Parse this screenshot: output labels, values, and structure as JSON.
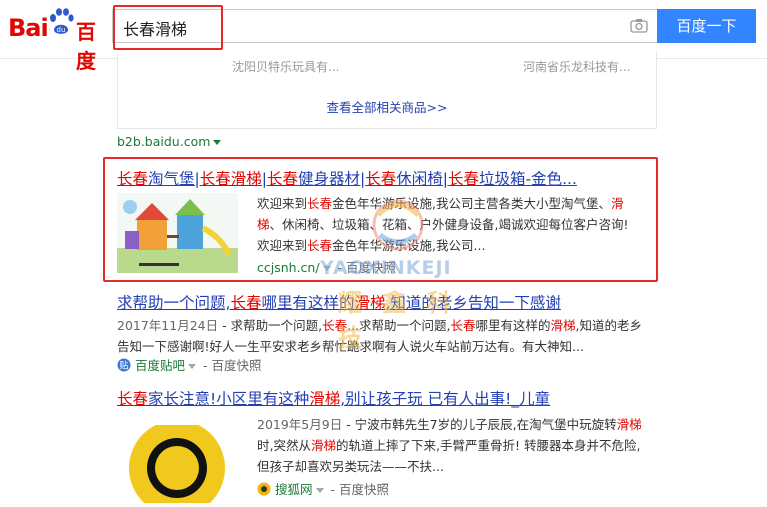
{
  "header": {
    "logo_bai": "Bai",
    "logo_du": "百度",
    "search_value": "长春滑梯",
    "search_button": "百度一下"
  },
  "product_panel": {
    "item1": "沈阳贝特乐玩具有...",
    "item2": "河南省乐龙科技有...",
    "view_all": "查看全部相关商品>>"
  },
  "source_url": "b2b.baidu.com",
  "results": [
    {
      "title_parts": [
        "长春",
        "淘气堡|",
        "长春",
        "滑梯",
        "|",
        "长春",
        "健身器材|",
        "长春",
        "休闲椅|",
        "长春",
        "垃圾箱-金色..."
      ],
      "snippet_line1_parts": [
        "欢迎来到",
        "长春",
        "金色年华游乐设施,我公司主营各类大小型淘气堡、",
        "滑"
      ],
      "snippet_line2_parts": [
        "梯",
        "、休闲椅、垃圾箱、花箱、户外健身设备,竭诚欢迎每位客户咨询!"
      ],
      "snippet_line3_parts": [
        "欢迎来到",
        "长春",
        "金色年华游乐设施,我公司..."
      ],
      "domain": "ccjsnh.cn/",
      "cache": "百度快照"
    },
    {
      "title_parts": [
        "求帮助一个问题,",
        "长春",
        "哪里有这样的",
        "滑梯",
        ",知道的老乡告知一下感谢"
      ],
      "date": "2017年11月24日",
      "snippet_line1_parts": [
        " - 求帮助一个问题,",
        "长春",
        "...求帮助一个问题,",
        "长春",
        "哪里有这样的",
        "滑梯",
        ",知道的老乡"
      ],
      "snippet_line2": "告知一下感谢啊!好人一生平安求老乡帮忙跪求啊有人说火车站前万达有。有大神知...",
      "source": "百度贴吧",
      "cache": "百度快照"
    },
    {
      "title_parts": [
        "长春",
        "家长注意!小区里有这种",
        "滑梯",
        ",别让孩子玩 已有人出事!_儿童"
      ],
      "date": "2019年5月9日",
      "snippet_line1": " - 宁波市韩先生7岁的儿子辰辰,在淘气堡中玩旋转",
      "snippet_line1_hl": "滑梯",
      "snippet_line2_parts": [
        "时,突然从",
        "滑梯",
        "的轨道上摔了下来,手臂严重骨折! 转腰器本身并不危险,"
      ],
      "snippet_line3": "但孩子却喜欢另类玩法——不扶...",
      "source": "搜狐网",
      "cache": "百度快照"
    }
  ],
  "watermark": {
    "line1": "YAOXINKEJI",
    "line2": "耀 鑫 科 技"
  },
  "colors": {
    "brand_red": "#e10602",
    "link_blue": "#2440b3",
    "url_green": "#1a7a36",
    "button_blue": "#3385ff",
    "annotation_red": "#e62a2a"
  }
}
